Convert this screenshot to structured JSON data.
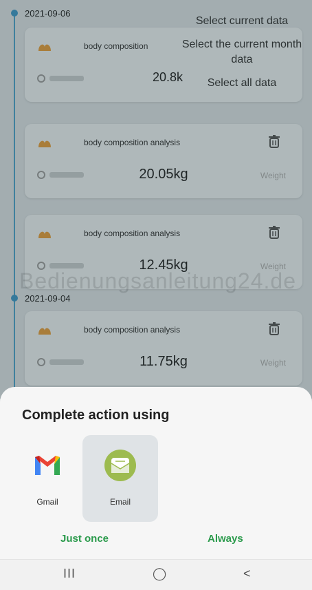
{
  "records": [
    {
      "date": "2021-09-06",
      "items": [
        {
          "title": "body composition",
          "value": "20.8k",
          "unit": ""
        },
        {
          "title": "body composition analysis",
          "value": "20.05kg",
          "unit": "Weight"
        },
        {
          "title": "body composition analysis",
          "value": "12.45kg",
          "unit": "Weight"
        }
      ]
    },
    {
      "date": "2021-09-04",
      "items": [
        {
          "title": "body composition analysis",
          "value": "11.75kg",
          "unit": "Weight"
        }
      ]
    }
  ],
  "dropdown": {
    "items": [
      "Select current data",
      "Select the current month data",
      "Select all data"
    ]
  },
  "watermark": "Bedienungsanleitung24.de",
  "sheet": {
    "title": "Complete action using",
    "apps": [
      {
        "label": "Gmail",
        "icon": "gmail-icon"
      },
      {
        "label": "Email",
        "icon": "email-icon",
        "selected": true
      }
    ],
    "just_once": "Just once",
    "always": "Always"
  },
  "navbar": {
    "recents": "III",
    "home": "◯",
    "back": "<"
  },
  "colors": {
    "accent_green": "#2a9a4b",
    "timeline_blue": "#3f95c2"
  }
}
